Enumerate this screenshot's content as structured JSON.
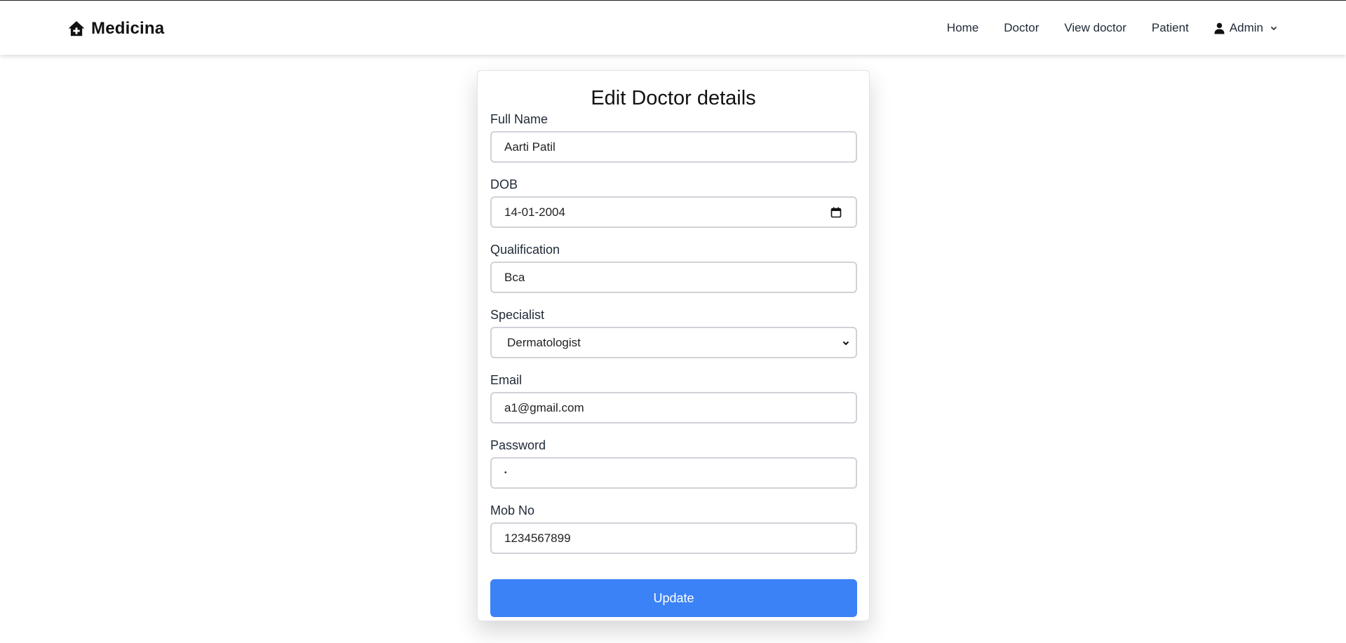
{
  "brand": {
    "name": "Medicina",
    "icon": "home-plus-icon"
  },
  "nav": {
    "links": [
      "Home",
      "Doctor",
      "View doctor",
      "Patient"
    ],
    "admin": {
      "label": "Admin",
      "icon": "user-icon",
      "caret": "chevron-down-icon"
    }
  },
  "form": {
    "title": "Edit Doctor details",
    "fields": {
      "full_name": {
        "label": "Full Name",
        "value": "Aarti Patil"
      },
      "dob": {
        "label": "DOB",
        "value": "14-01-2004",
        "icon": "calendar-icon"
      },
      "qualification": {
        "label": "Qualification",
        "value": "Bca"
      },
      "specialist": {
        "label": "Specialist",
        "value": "Dermatologist",
        "icon": "chevron-down-icon"
      },
      "email": {
        "label": "Email",
        "value": "a1@gmail.com"
      },
      "password": {
        "label": "Password",
        "value": "•"
      },
      "mobile": {
        "label": "Mob No",
        "value": "1234567899"
      }
    },
    "submit_label": "Update"
  },
  "colors": {
    "accent": "#3b82f6",
    "input_border": "#cfd3d8",
    "text": "#1f2937"
  }
}
